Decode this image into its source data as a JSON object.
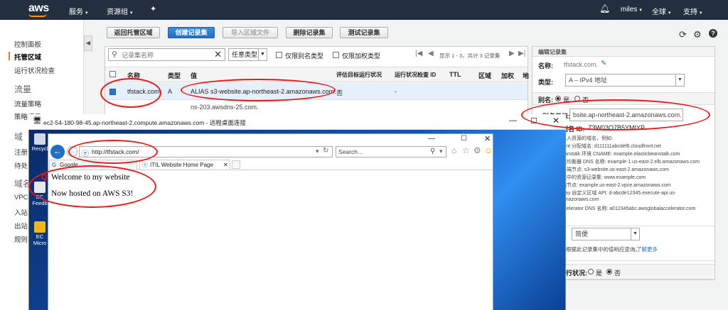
{
  "topbar": {
    "logo": "aws",
    "services": "服务",
    "resource_groups": "资源组",
    "user": "miles",
    "region": "全球",
    "support": "支持"
  },
  "sidebar": {
    "items": [
      {
        "label": "控制面板"
      },
      {
        "label": "托管区域",
        "active": true
      },
      {
        "label": "运行状况检查"
      }
    ],
    "traffic_head": "流量",
    "traffic_items": [
      "流量策略",
      "策略记录"
    ],
    "domain_head": "域",
    "domain_items": [
      "注册",
      "待处"
    ],
    "resolver_head": "域名",
    "resolver_items": [
      "VPC",
      "入站",
      "出站",
      "规则"
    ]
  },
  "toolbar": {
    "back": "返回托管区域",
    "create": "创建记录集",
    "import": "导入区域文件",
    "delete": "删除记录集",
    "test": "测试记录集"
  },
  "filter": {
    "search_placeholder": "记录集名称",
    "type": "任意类型",
    "alias_only": "仅限别名类型",
    "weighted_only": "仅限加权类型",
    "paging": "显示 1 - 3，共计 3 记录集"
  },
  "table": {
    "columns": [
      "名称",
      "类型",
      "值",
      "评估目标运行状况",
      "运行状况检查 ID",
      "TTL",
      "区域",
      "加权",
      "地"
    ],
    "rows": [
      {
        "name": "tfstack.com.",
        "type": "A",
        "value": "ALIAS s3-website.ap-northeast-2.amazonaws.com.",
        "eval": "否",
        "health": "-"
      },
      {
        "name": "",
        "type": "",
        "value": "ns-203.awsdns-25.com.",
        "eval": "",
        "health": ""
      }
    ]
  },
  "edit_panel": {
    "title": "编辑记录集",
    "name_label": "名称:",
    "name_value": "tfstack.com.",
    "type_label": "类型:",
    "type_value": "A – IPv4 地址",
    "alias_label": "别名:",
    "alias_yes": "是",
    "alias_no": "否",
    "alias_target_label": "别名目标:",
    "alias_target_value": "bsite.ap-northeast-2.amazonaws.com.",
    "zone_id_label": "别名 ID:",
    "zone_id_value": "Z3W03O7B5YMIYP",
    "help_lines": [
      "入入资源的域名，例如:",
      "ront 分配域名: d111111abcdef8.cloudfront.net",
      "eanstalk 环境 CNAME: example.elasticbeanstalk.com",
      "载均衡器 DNS 名称: example-1.us-east-2.elb.amazonaws.com",
      "终端节点: s3-website.us-east-2.amazonaws.com",
      "域中的资源记录集: www.example.com",
      "端节点: example.us-east-2.vpce.amazonaws.com",
      "way 自定义区域 API: d-abcde12345.execute-api.us-",
      "amazonaws.com",
      "ccelerator DNS 名称: a012345abc.awsglobalaccelerator.com"
    ],
    "routing_value": "简便",
    "routing_help": "根据此记录集中的值响应查询。",
    "routing_link": "了解更多",
    "health_label": "行状况:",
    "health_yes": "是",
    "health_no": "否"
  },
  "rdp": {
    "title": "ec2-54-180-98-45.ap-northeast-2.compute.amazonaws.com - 远程桌面连接",
    "icons": [
      "Recycl",
      "EC",
      "Feedb",
      "EC",
      "Micro"
    ]
  },
  "browser": {
    "url": "http://tfstack.com/",
    "search_placeholder": "Search...",
    "tabs": [
      {
        "label": "Google"
      },
      {
        "label": "ITIL Website Home Page"
      }
    ],
    "page": {
      "heading": "Welcome to my website",
      "line": "Now hosted on AWS S3!"
    }
  },
  "colors": {
    "aws_nav": "#232f3e",
    "aws_orange": "#ff9900",
    "primary_blue": "#1f6fc2",
    "annotation_red": "#e21b1b"
  }
}
